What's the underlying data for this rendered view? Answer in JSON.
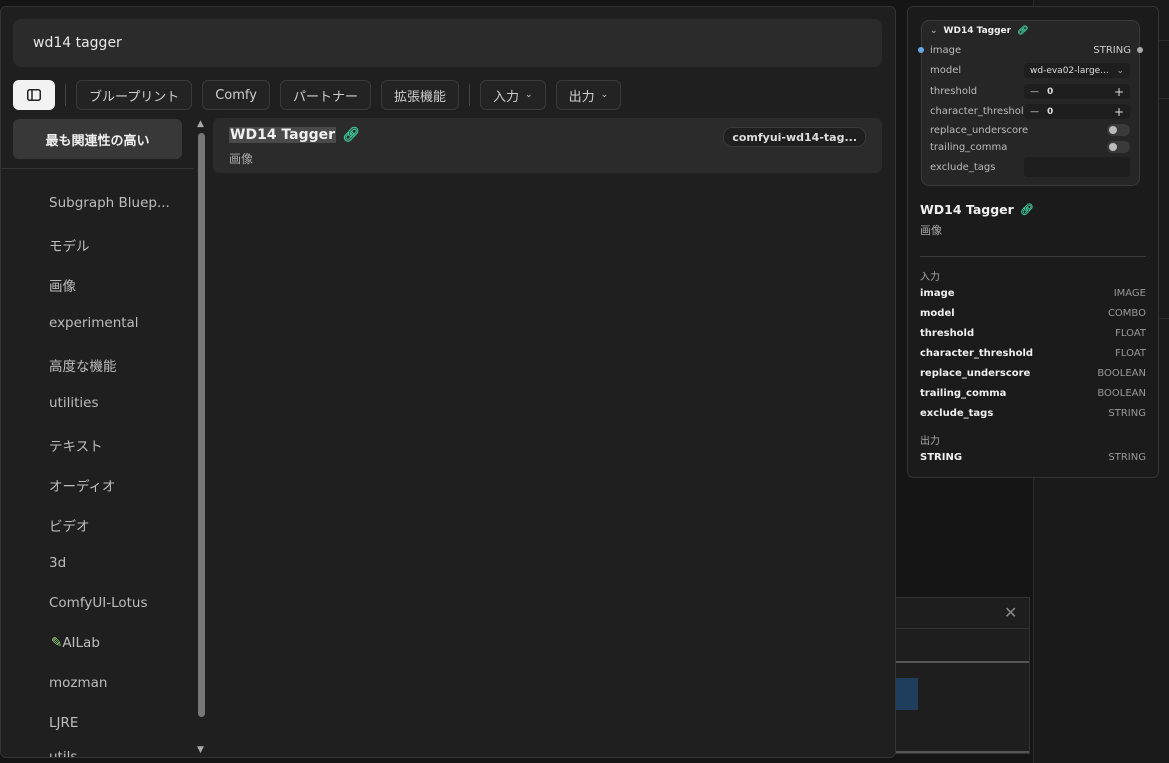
{
  "search": {
    "value": "wd14 tagger"
  },
  "filters": [
    {
      "label": "ブループリント"
    },
    {
      "label": "Comfy"
    },
    {
      "label": "パートナー"
    },
    {
      "label": "拡張機能"
    },
    {
      "label": "入力"
    },
    {
      "label": "出力"
    }
  ],
  "sidebar": {
    "active": "最も関連性の高い",
    "items": [
      "Subgraph Bluep...",
      "モデル",
      "画像",
      "experimental",
      "高度な機能",
      "utilities",
      "テキスト",
      "オーディオ",
      "ビデオ",
      "3d",
      "ComfyUI-Lotus",
      "AILab",
      "mozman",
      "LJRE",
      "utils"
    ]
  },
  "result": {
    "title": "WD14 Tagger",
    "category": "画像",
    "badge": "comfyui-wd14-tag..."
  },
  "node": {
    "title": "WD14 Tagger",
    "input_image": "image",
    "output_string": "STRING",
    "model_label": "model",
    "model_value": "wd-eva02-large...",
    "threshold_label": "threshold",
    "threshold_value": "0",
    "char_label": "character_threshold",
    "char_value": "0",
    "replace_label": "replace_underscore",
    "trailing_label": "trailing_comma",
    "exclude_label": "exclude_tags"
  },
  "preview": {
    "title": "WD14 Tagger",
    "category": "画像",
    "inputs_heading": "入力",
    "inputs": [
      {
        "name": "image",
        "type": "IMAGE"
      },
      {
        "name": "model",
        "type": "COMBO"
      },
      {
        "name": "threshold",
        "type": "FLOAT"
      },
      {
        "name": "character_threshold",
        "type": "FLOAT"
      },
      {
        "name": "replace_underscore",
        "type": "BOOLEAN"
      },
      {
        "name": "trailing_comma",
        "type": "BOOLEAN"
      },
      {
        "name": "exclude_tags",
        "type": "STRING"
      }
    ],
    "outputs_heading": "出力",
    "outputs": [
      {
        "name": "STRING",
        "type": "STRING"
      }
    ]
  },
  "colors": {
    "accent_chain": "#3cc49a",
    "input_dot": "#6aa7e8"
  }
}
